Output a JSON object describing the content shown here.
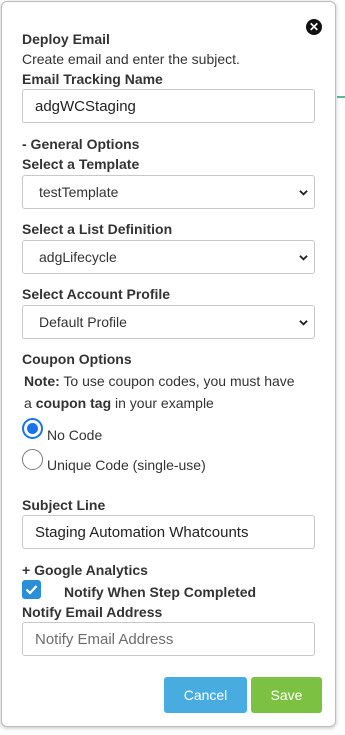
{
  "dialog": {
    "title": "Deploy Email",
    "subtitle": "Create email and enter the subject.",
    "close_icon": "close-circle-icon"
  },
  "tracking": {
    "label": "Email Tracking Name",
    "value": "adgWCStaging"
  },
  "general_options_label": "- General Options",
  "template": {
    "label": "Select a Template",
    "selected": "testTemplate"
  },
  "list_definition": {
    "label": "Select a List Definition",
    "selected": "adgLifecycle"
  },
  "account_profile": {
    "label": "Select Account Profile",
    "selected": "Default Profile"
  },
  "coupon": {
    "label": "Coupon Options",
    "note_bold": "Note:",
    "note_text": " To use coupon codes, you must have",
    "note_line2_pre": "a ",
    "note_line2_bold": "coupon tag",
    "note_line2_post": " in your example",
    "options": [
      {
        "label": "No Code",
        "checked": true
      },
      {
        "label": "Unique Code (single-use)",
        "checked": false
      }
    ]
  },
  "subject": {
    "label": "Subject Line",
    "value": "Staging Automation Whatcounts"
  },
  "google_analytics_label": "+ Google Analytics",
  "notify_step": {
    "label": "Notify When Step Completed",
    "checked": true
  },
  "notify_email": {
    "label": "Notify Email Address",
    "placeholder": "Notify Email Address"
  },
  "buttons": {
    "cancel": "Cancel",
    "save": "Save"
  },
  "colors": {
    "primary_blue": "#48ace0",
    "save_green": "#7cc142",
    "checkbox_blue": "#2a8fd6",
    "radio_blue": "#1a73e8"
  }
}
